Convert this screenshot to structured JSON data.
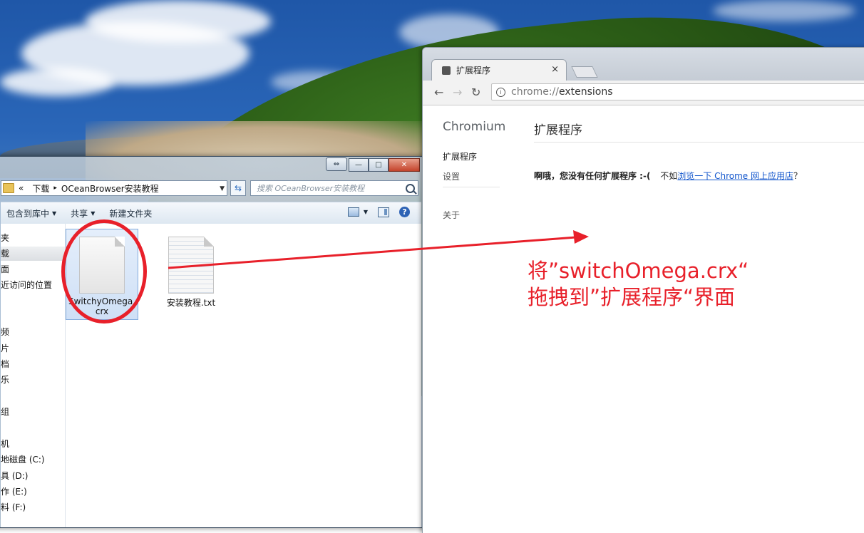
{
  "explorer": {
    "breadcrumb_prefix": "«",
    "breadcrumb_parent": "下载",
    "breadcrumb_sep": "▸",
    "breadcrumb_current": "OCeanBrowser安装教程",
    "search_placeholder": "搜索 OCeanBrowser安装教程",
    "toolbar": {
      "include_library": "包含到库中",
      "share": "共享",
      "new_folder": "新建文件夹"
    },
    "nav_items": [
      "夹",
      "载",
      "面",
      "近访问的位置",
      "频",
      "片",
      "档",
      "乐",
      "组",
      "机",
      "地磁盘 (C:)",
      "具 (D:)",
      "作 (E:)",
      "料 (F:)"
    ],
    "files": [
      {
        "name": "SwitchyOmega.crx",
        "line1": "SwitchyOmega.",
        "line2": "crx"
      },
      {
        "name": "安装教程.txt",
        "line1": "安装教程.txt",
        "line2": ""
      }
    ]
  },
  "chrome": {
    "tab_title": "扩展程序",
    "tab_close": "×",
    "url_scheme": "chrome://",
    "url_path": "extensions",
    "brand": "Chromium",
    "sidebar": [
      "扩展程序",
      "设置",
      "关于"
    ],
    "heading": "扩展程序",
    "empty_bold": "啊哦，您没有任何扩展程序 :-(",
    "empty_pre": "不如",
    "empty_link": "浏览一下 Chrome 网上应用店",
    "empty_post": "？"
  },
  "annotation": {
    "line1": "将”switchOmega.crx“",
    "line2": "拖拽到”扩展程序“界面",
    "color": "#e8202a"
  }
}
